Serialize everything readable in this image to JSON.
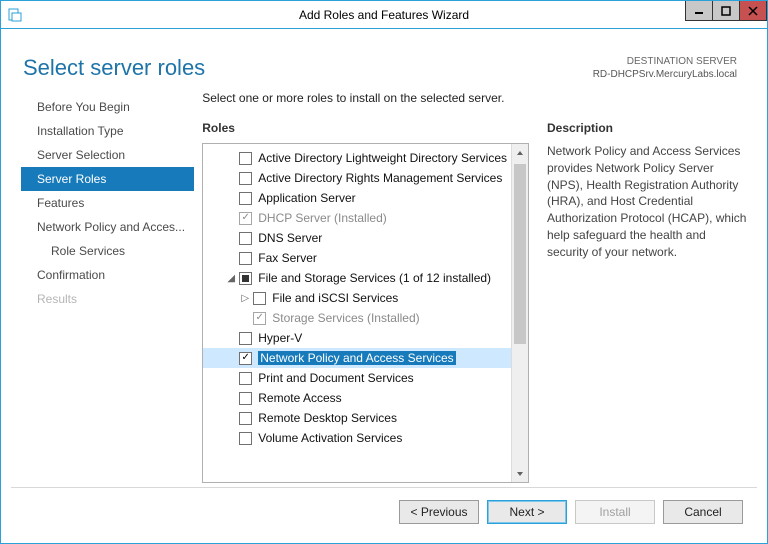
{
  "window": {
    "title": "Add Roles and Features Wizard"
  },
  "header": {
    "page_title": "Select server roles",
    "destination_label": "DESTINATION SERVER",
    "destination_value": "RD-DHCPSrv.MercuryLabs.local"
  },
  "sidebar": {
    "items": [
      {
        "label": "Before You Begin",
        "active": false,
        "disabled": false,
        "sub": false
      },
      {
        "label": "Installation Type",
        "active": false,
        "disabled": false,
        "sub": false
      },
      {
        "label": "Server Selection",
        "active": false,
        "disabled": false,
        "sub": false
      },
      {
        "label": "Server Roles",
        "active": true,
        "disabled": false,
        "sub": false
      },
      {
        "label": "Features",
        "active": false,
        "disabled": false,
        "sub": false
      },
      {
        "label": "Network Policy and Acces...",
        "active": false,
        "disabled": false,
        "sub": false
      },
      {
        "label": "Role Services",
        "active": false,
        "disabled": false,
        "sub": true
      },
      {
        "label": "Confirmation",
        "active": false,
        "disabled": false,
        "sub": false
      },
      {
        "label": "Results",
        "active": false,
        "disabled": true,
        "sub": false
      }
    ]
  },
  "panel": {
    "instruction": "Select one or more roles to install on the selected server.",
    "roles_heading": "Roles",
    "description_heading": "Description",
    "description_text": "Network Policy and Access Services provides Network Policy Server (NPS), Health Registration Authority (HRA), and Host Credential Authorization Protocol (HCAP), which help safeguard the health and security of your network."
  },
  "roles": [
    {
      "label": "Active Directory Lightweight Directory Services",
      "indent": 1,
      "state": "unchecked"
    },
    {
      "label": "Active Directory Rights Management Services",
      "indent": 1,
      "state": "unchecked"
    },
    {
      "label": "Application Server",
      "indent": 1,
      "state": "unchecked"
    },
    {
      "label": "DHCP Server (Installed)",
      "indent": 1,
      "state": "checked-disabled"
    },
    {
      "label": "DNS Server",
      "indent": 1,
      "state": "unchecked"
    },
    {
      "label": "Fax Server",
      "indent": 1,
      "state": "unchecked"
    },
    {
      "label": "File and Storage Services (1 of 12 installed)",
      "indent": 1,
      "state": "partial",
      "arrow": "expanded"
    },
    {
      "label": "File and iSCSI Services",
      "indent": 2,
      "state": "unchecked",
      "arrow": "collapsed"
    },
    {
      "label": "Storage Services (Installed)",
      "indent": 2,
      "state": "checked-disabled"
    },
    {
      "label": "Hyper-V",
      "indent": 1,
      "state": "unchecked"
    },
    {
      "label": "Network Policy and Access Services",
      "indent": 1,
      "state": "checked",
      "selected": true
    },
    {
      "label": "Print and Document Services",
      "indent": 1,
      "state": "unchecked"
    },
    {
      "label": "Remote Access",
      "indent": 1,
      "state": "unchecked"
    },
    {
      "label": "Remote Desktop Services",
      "indent": 1,
      "state": "unchecked"
    },
    {
      "label": "Volume Activation Services",
      "indent": 1,
      "state": "unchecked"
    }
  ],
  "footer": {
    "btn_previous": "< Previous",
    "btn_next": "Next >",
    "btn_install": "Install",
    "btn_cancel": "Cancel"
  }
}
